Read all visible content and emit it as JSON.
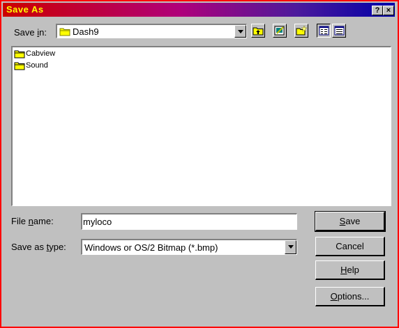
{
  "window": {
    "title": "Save As",
    "help_button": "?",
    "close_button": "×"
  },
  "save_in": {
    "label_pre": "Save ",
    "label_key": "i",
    "label_post": "n:",
    "value": "Dash9"
  },
  "toolbar": {
    "icons": [
      "up-one-level-icon",
      "desktop-icon",
      "new-folder-icon",
      "list-view-icon",
      "details-view-icon"
    ]
  },
  "files": [
    {
      "name": "Cabview",
      "icon": "folder-icon"
    },
    {
      "name": "Sound",
      "icon": "folder-icon"
    }
  ],
  "file_name": {
    "label_pre": "File ",
    "label_key": "n",
    "label_post": "ame:",
    "value": "myloco"
  },
  "save_as_type": {
    "label_pre": "Save as ",
    "label_key": "t",
    "label_post": "ype:",
    "value": "Windows or OS/2 Bitmap (*.bmp)"
  },
  "buttons": {
    "save_key": "S",
    "save_rest": "ave",
    "cancel": "Cancel",
    "help_key": "H",
    "help_rest": "elp",
    "options_key": "O",
    "options_rest": "ptions..."
  },
  "colors": {
    "title_text": "#ffff00",
    "window_border": "#ff0000",
    "folder_fill": "#ffff00"
  }
}
